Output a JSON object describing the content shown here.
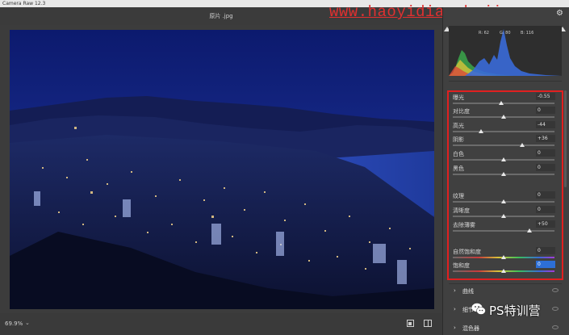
{
  "window": {
    "title": "Camera Raw 12.3"
  },
  "file": {
    "name": "原片 .jpg"
  },
  "watermark": {
    "text": "www.haoyidiansheji.com"
  },
  "histogram": {
    "r_label": "R: 62",
    "g_label": "G: 80",
    "b_label": "B: 116"
  },
  "basic": {
    "sliders": [
      {
        "label": "曝光",
        "value": "-0.55",
        "pos": 0.48
      },
      {
        "label": "对比度",
        "value": "0",
        "pos": 0.5
      },
      {
        "label": "高光",
        "value": "-44",
        "pos": 0.28
      },
      {
        "label": "阴影",
        "value": "+36",
        "pos": 0.68
      },
      {
        "label": "白色",
        "value": "0",
        "pos": 0.5
      },
      {
        "label": "黑色",
        "value": "0",
        "pos": 0.5
      },
      {
        "label": "纹理",
        "value": "0",
        "pos": 0.5
      },
      {
        "label": "清晰度",
        "value": "0",
        "pos": 0.5
      },
      {
        "label": "去除薄雾",
        "value": "+50",
        "pos": 0.75
      },
      {
        "label": "自然饱和度",
        "value": "0",
        "pos": 0.5
      },
      {
        "label": "饱和度",
        "value": "0",
        "pos": 0.5
      }
    ]
  },
  "sections": [
    {
      "title": "曲线"
    },
    {
      "title": "细节"
    },
    {
      "title": "混色器"
    }
  ],
  "status": {
    "zoom": "69.9%"
  },
  "brand": {
    "text": "PS特训营"
  }
}
